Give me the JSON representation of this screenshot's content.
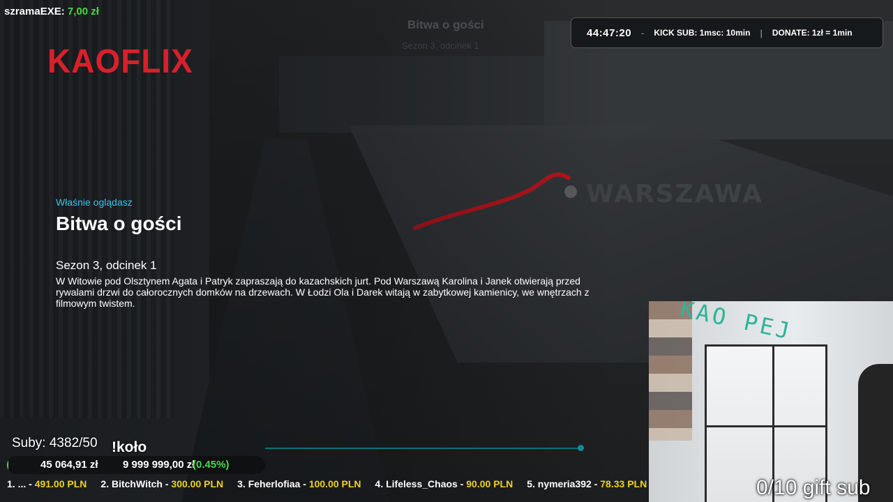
{
  "donor": {
    "name": "szramaEXE:",
    "amount": "7,00 zł"
  },
  "logo": "KAOFLIX",
  "faded": {
    "title": "Bitwa o gości",
    "subtitle": "Sezon 3, odcinek 1"
  },
  "timer": {
    "time": "44:47:20",
    "sep1": "-",
    "kick": "KICK SUB: 1msc: 10min",
    "sep2": "|",
    "donate": "DONATE: 1zł = 1min"
  },
  "scene": {
    "city_label": "WARSZAWA"
  },
  "player": {
    "watching_label": "Właśnie oglądasz",
    "title": "Bitwa o gości",
    "episode": "Sezon 3, odcinek 1",
    "description": "W Witowie pod Olsztynem Agata i Patryk zapraszają do kazachskich jurt. Pod Warszawą Karolina i Janek otwierają przed rywalami drzwi do całorocznych domków na drzewach. W Łodzi Ola i Darek witają w zabytkowej kamienicy, we wnętrzach z filmowym twistem.",
    "seek_fraction": 0.99
  },
  "webcam": {
    "sign": "KAO PEJ"
  },
  "subs": "Suby: 4382/50",
  "command": "!koło",
  "goal": {
    "current": "45 064,91 zł",
    "target": "9 999 999,00 zł",
    "percent": "(0.45%)",
    "fraction": 0.0045
  },
  "gift_sub": "0/10 gift sub",
  "top_donors": [
    {
      "label": "1. ... - ",
      "value": "491.00 PLN"
    },
    {
      "label": "2. BitchWitch - ",
      "value": "300.00 PLN"
    },
    {
      "label": "3. Feherlofiaa - ",
      "value": "100.00 PLN"
    },
    {
      "label": "4. Lifeless_Chaos - ",
      "value": "90.00 PLN"
    },
    {
      "label": "5. nymeria392 - ",
      "value": "78.33 PLN"
    }
  ],
  "colors": {
    "brand_red": "#d8202b",
    "accent_cyan": "#3bc2e8",
    "money_green": "#4cd64c",
    "donor_yellow": "#f0d21d"
  }
}
